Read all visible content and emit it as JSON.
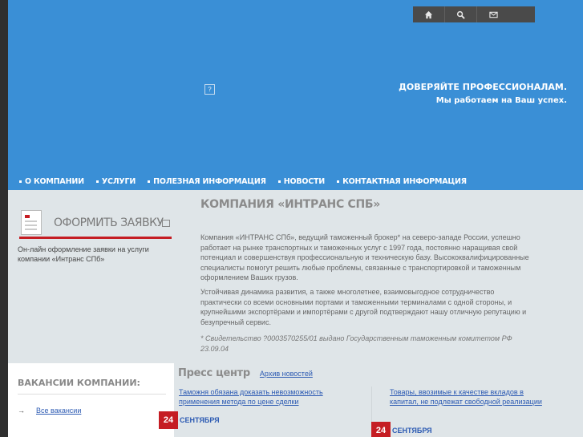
{
  "header": {
    "slogan_line1": "ДОВЕРЯЙТЕ ПРОФЕССИОНАЛАМ.",
    "slogan_line2": "Мы работаем на Ваш успех.",
    "placeholder_glyph": "?",
    "toolbar_icons": [
      "home-icon",
      "search-icon",
      "mail-icon"
    ]
  },
  "nav": {
    "items": [
      {
        "label": "О КОМПАНИИ"
      },
      {
        "label": "УСЛУГИ"
      },
      {
        "label": "ПОЛЕЗНАЯ ИНФОРМАЦИЯ"
      },
      {
        "label": "НОВОСТИ"
      },
      {
        "label": "КОНТАКТНАЯ ИНФОРМАЦИЯ"
      }
    ]
  },
  "order": {
    "title": "ОФОРМИТЬ ЗАЯВКУ",
    "description": "Он-лайн оформление заявки на услуги компании «Интранс СПб»"
  },
  "vacancies": {
    "heading": "ВАКАНСИИ КОМПАНИИ:",
    "arrow": "→",
    "link": "Все вакансии"
  },
  "content": {
    "title": "КОМПАНИЯ «ИНТРАНС СПБ»",
    "paragraph1": "Компания «ИНТРАНС СПб», ведущий таможенный брокер* на северо-западе России, успешно работает на рынке транспортных и таможенных услуг с 1997 года, постоянно наращивая свой потенциал и совершенствуя профессиональную и техническую базу. Высококвалифицированные специалисты помогут решить любые проблемы, связанные с транспортировкой и таможенным оформлением Ваших грузов.",
    "paragraph2": "Устойчивая динамика развития, а также многолетнее, взаимовыгодное сотрудничество практически со всеми основными портами и таможенными терминалами с одной стороны, и крупнейшими экспортёрами и импортёрами с другой подтверждают нашу отличную репутацию и безупречный сервис.",
    "footnote": "* Свидетельство ?0003570255/01 выдано Государственным таможенным комитетом РФ 23.09.04"
  },
  "press": {
    "heading": "Пресс центр",
    "archive": "Архив новостей",
    "news": [
      {
        "title": "Таможня обязана доказать невозможность применения метода по цене сделки",
        "day": "24",
        "month": "СЕНТЯБРЯ"
      },
      {
        "title": "Товары, ввозимые к качестве вкладов в капитал, не подлежат свободной реализации",
        "day": "24",
        "month": "СЕНТЯБРЯ"
      }
    ]
  },
  "colors": {
    "header_blue": "#3a8fd6",
    "accent_red": "#c51d23",
    "link_blue": "#2d5bb3"
  }
}
